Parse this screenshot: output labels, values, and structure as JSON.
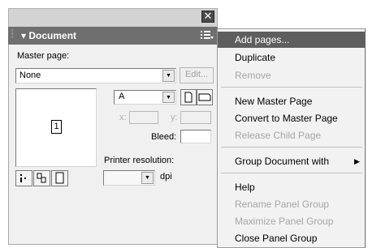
{
  "window": {
    "close_glyph": "✕"
  },
  "panel": {
    "title": "Document",
    "master_page_label": "Master page:",
    "master_page_value": "None",
    "edit_button": "Edit...",
    "thumbnail_page_number": "1",
    "size_value": "A",
    "x_label": "x:",
    "y_label": "y:",
    "bleed_label": "Bleed:",
    "printer_resolution_label": "Printer resolution:",
    "dpi_label": "dpi"
  },
  "menu": {
    "items": [
      {
        "label": "Add pages...",
        "enabled": true,
        "highlighted": true
      },
      {
        "label": "Duplicate",
        "enabled": true
      },
      {
        "label": "Remove",
        "enabled": false
      },
      {
        "label": "New Master Page",
        "enabled": true
      },
      {
        "label": "Convert to Master Page",
        "enabled": true
      },
      {
        "label": "Release Child Page",
        "enabled": false
      },
      {
        "label": "Group Document with",
        "enabled": true,
        "has_submenu": true
      },
      {
        "label": "Help",
        "enabled": true
      },
      {
        "label": "Rename Panel Group",
        "enabled": false
      },
      {
        "label": "Maximize Panel Group",
        "enabled": false
      },
      {
        "label": "Close Panel Group",
        "enabled": true
      }
    ]
  },
  "icons": [
    "close-icon",
    "grip-icon",
    "collapse-arrow-icon",
    "panel-menu-icon",
    "dropdown-arrow-icon",
    "portrait-page-icon",
    "landscape-page-icon",
    "page-layout-icon",
    "submenu-arrow-icon"
  ],
  "colors": {
    "header": "#6f6f6f",
    "highlight": "#5e5e5e",
    "panel_bg": "#f0f0f0",
    "menu_bg": "#f2f2f2"
  }
}
